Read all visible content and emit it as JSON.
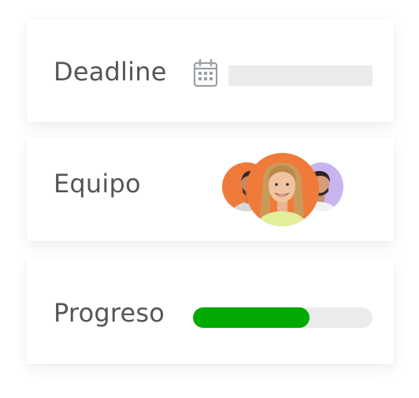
{
  "deadline": {
    "label": "Deadline",
    "icon": "calendar-icon",
    "date_value": ""
  },
  "team": {
    "label": "Equipo",
    "avatars": [
      {
        "name": "avatar-left",
        "bg": "#f07a3a"
      },
      {
        "name": "avatar-center",
        "bg": "#f07a3a"
      },
      {
        "name": "avatar-right",
        "bg": "#c9b4f0"
      }
    ]
  },
  "progress": {
    "label": "Progreso",
    "fraction": 0.65,
    "fill_color": "#00aa00",
    "track_color": "#ebebeb"
  },
  "colors": {
    "label_text": "#555555",
    "icon": "#9aa0a6"
  }
}
